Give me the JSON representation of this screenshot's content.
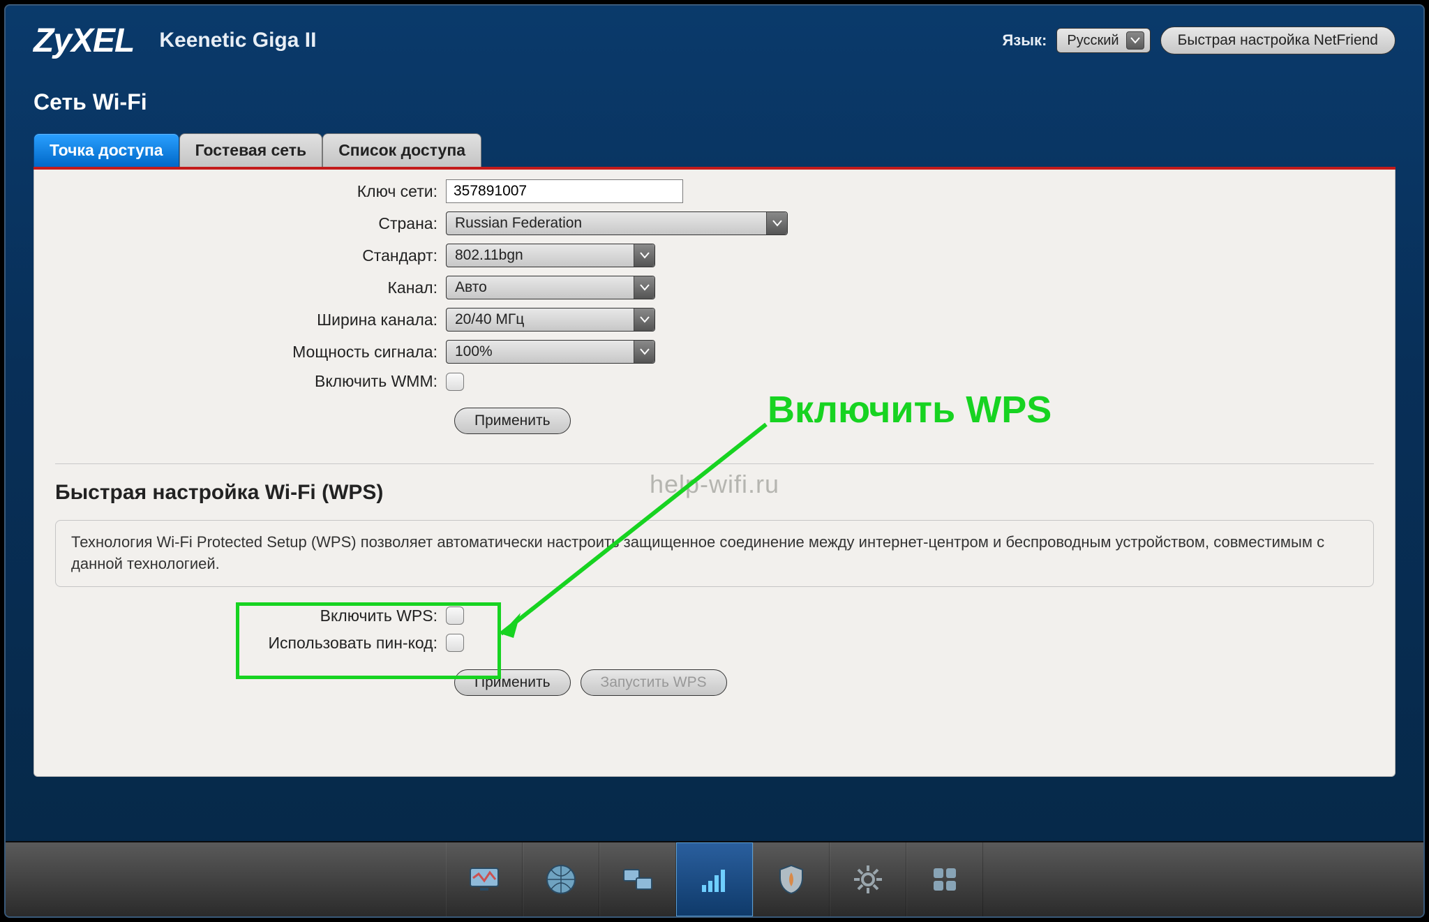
{
  "header": {
    "logo_text": "ZyXEL",
    "product_name": "Keenetic Giga II",
    "language_label": "Язык:",
    "language_value": "Русский",
    "quick_setup_label": "Быстрая настройка NetFriend"
  },
  "page_title": "Сеть Wi-Fi",
  "tabs": [
    {
      "label": "Точка доступа",
      "active": true
    },
    {
      "label": "Гостевая сеть",
      "active": false
    },
    {
      "label": "Список доступа",
      "active": false
    }
  ],
  "form": {
    "network_key_label": "Ключ сети:",
    "network_key_value": "357891007",
    "country_label": "Страна:",
    "country_value": "Russian Federation",
    "standard_label": "Стандарт:",
    "standard_value": "802.11bgn",
    "channel_label": "Канал:",
    "channel_value": "Авто",
    "width_label": "Ширина канала:",
    "width_value": "20/40 МГц",
    "power_label": "Мощность сигнала:",
    "power_value": "100%",
    "wmm_label": "Включить WMM:",
    "apply_label": "Применить"
  },
  "wps": {
    "section_title": "Быстрая настройка Wi-Fi (WPS)",
    "info_text": "Технология Wi-Fi Protected Setup (WPS) позволяет автоматически настроить защищенное соединение между интернет-центром и беспроводным устройством, совместимым с данной технологией.",
    "enable_label": "Включить WPS:",
    "use_pin_label": "Использовать пин-код:",
    "apply_label": "Применить",
    "start_label": "Запустить WPS"
  },
  "watermark": "help-wifi.ru",
  "annotation": {
    "callout_text": "Включить  WPS"
  },
  "colors": {
    "accent_green": "#17d321",
    "tab_blue": "#0068c8",
    "red_bar": "#c31b1b"
  }
}
